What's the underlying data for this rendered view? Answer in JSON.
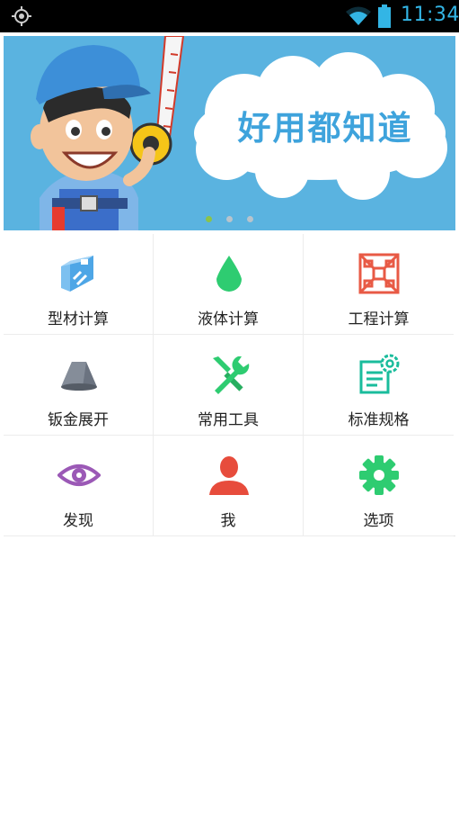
{
  "status_bar": {
    "time": "11:34",
    "icons": [
      "gps-icon",
      "wifi-icon",
      "battery-icon"
    ],
    "color": "#33b5e5"
  },
  "banner": {
    "slogan": "好用都知道",
    "page_count": 3,
    "active_page": 1,
    "background": "#5ab3e0"
  },
  "menu": {
    "items": [
      {
        "label": "型材计算",
        "icon": "profile-beam-icon",
        "color": "#4ea6e6"
      },
      {
        "label": "液体计算",
        "icon": "liquid-drop-icon",
        "color": "#2ecc71"
      },
      {
        "label": "工程计算",
        "icon": "engineering-frame-icon",
        "color": "#e85a45"
      },
      {
        "label": "钣金展开",
        "icon": "sheet-metal-cone-icon",
        "color": "#6b7380"
      },
      {
        "label": "常用工具",
        "icon": "tools-wrench-screwdriver-icon",
        "color": "#2ecc71"
      },
      {
        "label": "标准规格",
        "icon": "standard-document-gear-icon",
        "color": "#1abc9c"
      },
      {
        "label": "发现",
        "icon": "eye-icon",
        "color": "#9b59b6"
      },
      {
        "label": "我",
        "icon": "user-icon",
        "color": "#e74c3c"
      },
      {
        "label": "选项",
        "icon": "settings-gear-icon",
        "color": "#2ecc71"
      }
    ]
  }
}
